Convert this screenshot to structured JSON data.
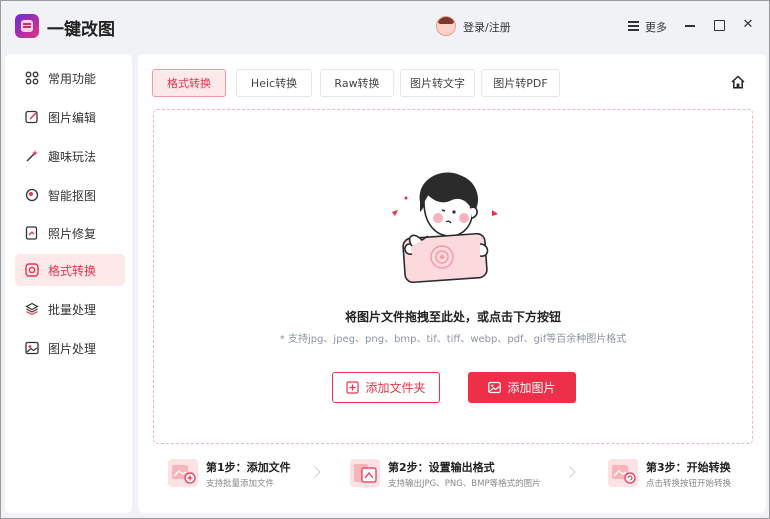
{
  "app": {
    "title": "一键改图"
  },
  "header": {
    "login_label": "登录/注册",
    "more_label": "更多"
  },
  "sidebar": {
    "items": [
      {
        "label": "常用功能",
        "icon": "grid-icon"
      },
      {
        "label": "图片编辑",
        "icon": "edit-icon"
      },
      {
        "label": "趣味玩法",
        "icon": "magic-wand-icon"
      },
      {
        "label": "智能抠图",
        "icon": "cutout-icon"
      },
      {
        "label": "照片修复",
        "icon": "photo-repair-icon"
      },
      {
        "label": "格式转换",
        "icon": "format-convert-icon",
        "active": true
      },
      {
        "label": "批量处理",
        "icon": "layers-icon"
      },
      {
        "label": "图片处理",
        "icon": "image-icon"
      }
    ]
  },
  "tabs": [
    {
      "label": "格式转换",
      "active": true
    },
    {
      "label": "Heic转换"
    },
    {
      "label": "Raw转换"
    },
    {
      "label": "图片转文字"
    },
    {
      "label": "图片转PDF"
    }
  ],
  "dropzone": {
    "title": "将图片文件拖拽至此处，或点击下方按钮",
    "subtitle": "* 支持jpg、jpeg、png、bmp、tif、tiff、webp、pdf、gif等百余种图片格式",
    "add_folder_label": "添加文件夹",
    "add_image_label": "添加图片"
  },
  "steps": [
    {
      "title": "第1步：添加文件",
      "desc": "支持批量添加文件"
    },
    {
      "title": "第2步：设置输出格式",
      "desc": "支持输出JPG、PNG、BMP等格式的图片"
    },
    {
      "title": "第3步：开始转换",
      "desc": "点击转换按钮开始转换"
    }
  ],
  "colors": {
    "accent": "#ee2f4a",
    "accent_light": "#fde8ea"
  }
}
